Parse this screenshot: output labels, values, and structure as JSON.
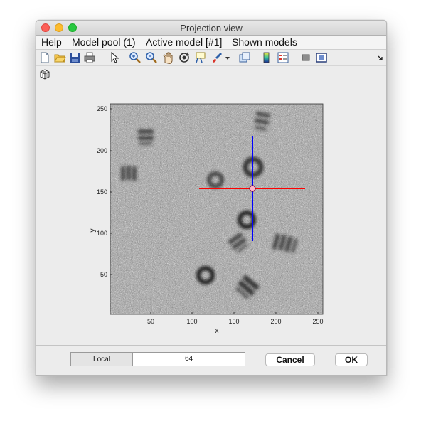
{
  "window": {
    "title": "Projection view"
  },
  "menu": [
    "Help",
    "Model pool (1)",
    "Active model [#1]",
    "Shown models"
  ],
  "toolbar": {
    "icons": [
      "new-file-icon",
      "open-folder-icon",
      "save-icon",
      "print-icon",
      "pointer-icon",
      "zoom-in-icon",
      "zoom-out-icon",
      "pan-hand-icon",
      "rotate-icon",
      "data-cursor-icon",
      "brush-icon",
      "dropdown-arrow-icon",
      "link-icon",
      "colorbar-icon",
      "legend-icon",
      "hide-plot-tools-icon",
      "show-plot-tools-icon",
      "dock-arrow-icon"
    ],
    "row2_icon": "3d-cube-icon"
  },
  "plot": {
    "xlabel": "x",
    "ylabel": "y",
    "xticks": [
      "50",
      "100",
      "150",
      "200",
      "250"
    ],
    "yticks": [
      "50",
      "100",
      "150",
      "200",
      "250"
    ],
    "xlim": [
      0,
      250
    ],
    "ylim": [
      0,
      250
    ],
    "crosshair": {
      "x": 171,
      "y": 178
    },
    "horizontal_line_color": "#ff0000",
    "vertical_line_color": "#0000ff"
  },
  "footer": {
    "label": "Local",
    "value": "64",
    "cancel": "Cancel",
    "ok": "OK"
  }
}
